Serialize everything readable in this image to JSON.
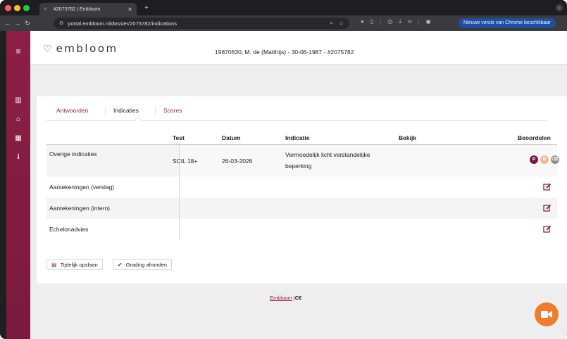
{
  "browser": {
    "tab_title": "#2075782 | Embloom",
    "new_tab_symbol": "+",
    "url": "portal.embloom.nl/dossier/2075782/indications",
    "update_banner": "Nieuwe versie van Chrome beschikbaar"
  },
  "header": {
    "logo_text": "embloom",
    "patient_line": "19870630, M. de (Matthijs) - 30-06-1987 - #2075782"
  },
  "tabs": [
    {
      "label": "Antwoorden"
    },
    {
      "label": "Indicaties"
    },
    {
      "label": "Scores"
    }
  ],
  "table": {
    "columns": {
      "test": "Test",
      "datum": "Datum",
      "indicatie": "Indicatie",
      "bekijk": "Bekijk",
      "beoordelen": "Beoordelen"
    },
    "rows": [
      {
        "label": "Overige indicaties",
        "test": "SCIL 18+",
        "datum": "26-03-2026",
        "indicatie_line1": "Vermoedelijk licht verstandelijke",
        "indicatie_line2": "beperking",
        "badges": {
          "p": "P",
          "b": "B"
        }
      },
      {
        "label": "Aantekeningen (verslag)"
      },
      {
        "label": "Aantekeningen (intern)"
      },
      {
        "label": "Echelonadvies"
      }
    ]
  },
  "buttons": {
    "save": "Tijdelijk opslaan",
    "finish": "Grading afronden"
  },
  "footer": {
    "link": "Embloom",
    "separator": "|",
    "mark": "C€"
  },
  "colors": {
    "brand": "#8c1f45",
    "accent_orange": "#ef7d2b",
    "badge_p": "#7a1a3d",
    "badge_b": "#f1b88f",
    "badge_delete": "#8e8e8e"
  }
}
